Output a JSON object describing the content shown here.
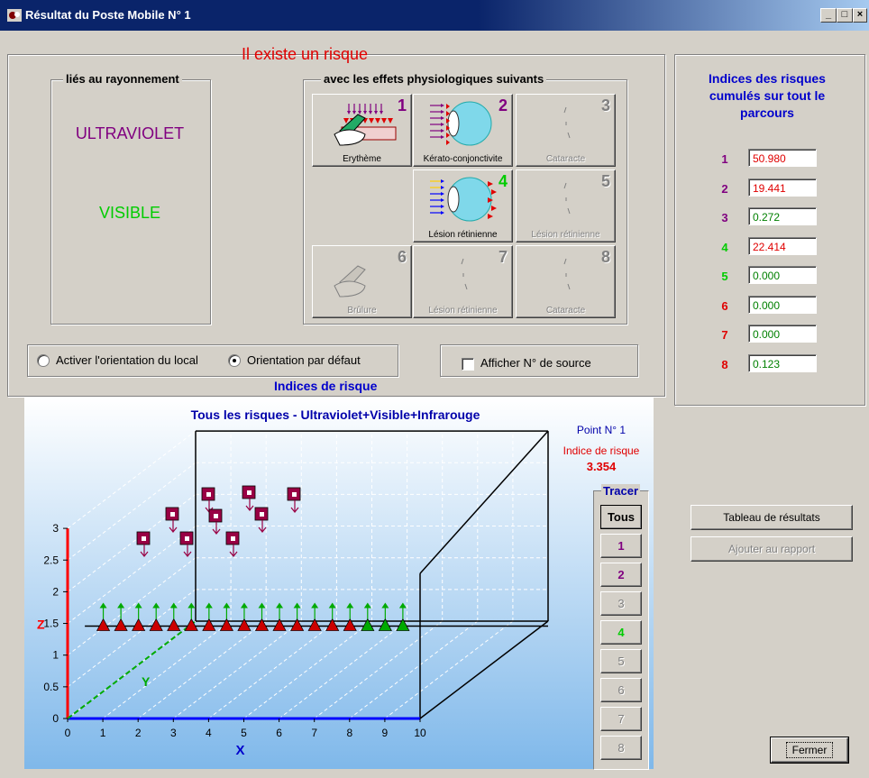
{
  "window": {
    "title": "Résultat du Poste Mobile N° 1"
  },
  "window_controls": {
    "minimize": "_",
    "maximize": "□",
    "close": "×"
  },
  "risk_heading": "Il existe un risque",
  "radiation_group": {
    "label": "liés au rayonnement",
    "items": [
      {
        "text": "ULTRAVIOLET",
        "color": "#800080"
      },
      {
        "text": "VISIBLE",
        "color": "#00cc00"
      }
    ]
  },
  "effects_group": {
    "label": "avec les effets physiologiques suivants",
    "buttons": [
      {
        "num": "1",
        "label": "Erythème",
        "enabled": true,
        "num_color": "#800080"
      },
      {
        "num": "2",
        "label": "Kérato-conjonctivite",
        "enabled": true,
        "num_color": "#800080"
      },
      {
        "num": "3",
        "label": "Cataracte",
        "enabled": false
      },
      {
        "num": "4",
        "label": "Lésion rétinienne",
        "enabled": true,
        "num_color": "#00cc00"
      },
      {
        "num": "5",
        "label": "Lésion rétinienne",
        "enabled": false
      },
      {
        "num": "6",
        "label": "Brûlure",
        "enabled": false
      },
      {
        "num": "7",
        "label": "Lésion rétinienne",
        "enabled": false
      },
      {
        "num": "8",
        "label": "Cataracte",
        "enabled": false
      }
    ]
  },
  "orientation": {
    "option_local": "Activer l'orientation du local",
    "option_default": "Orientation par défaut",
    "selected": "default"
  },
  "source_checkbox": {
    "label": "Afficher N° de source",
    "checked": false
  },
  "cumulative": {
    "title": "Indices des risques cumulés sur tout le parcours",
    "rows": [
      {
        "num": "1",
        "value": "50.980",
        "num_color": "#800080",
        "value_color": "#e00000"
      },
      {
        "num": "2",
        "value": "19.441",
        "num_color": "#800080",
        "value_color": "#e00000"
      },
      {
        "num": "3",
        "value": "0.272",
        "num_color": "#800080",
        "value_color": "#008000"
      },
      {
        "num": "4",
        "value": "22.414",
        "num_color": "#00cc00",
        "value_color": "#e00000"
      },
      {
        "num": "5",
        "value": "0.000",
        "num_color": "#00cc00",
        "value_color": "#008000"
      },
      {
        "num": "6",
        "value": "0.000",
        "num_color": "#e00000",
        "value_color": "#008000"
      },
      {
        "num": "7",
        "value": "0.000",
        "num_color": "#e00000",
        "value_color": "#008000"
      },
      {
        "num": "8",
        "value": "0.123",
        "num_color": "#e00000",
        "value_color": "#008000"
      }
    ]
  },
  "chart_section": {
    "label": "Indices de risque"
  },
  "chart_data": {
    "type": "scatter",
    "title": "Tous les risques - Ultraviolet+Visible+Infrarouge",
    "xlabel": "X",
    "ylabel": "Y",
    "zlabel": "Z",
    "xlim": [
      0,
      10
    ],
    "zlim": [
      0,
      3
    ],
    "x_ticks": [
      "0",
      "1",
      "2",
      "3",
      "4",
      "5",
      "6",
      "7",
      "8",
      "9",
      "10"
    ],
    "z_ticks": [
      "0",
      "0.5",
      "1",
      "1.5",
      "2",
      "2.5",
      "3"
    ],
    "grid": true,
    "point_info": {
      "label": "Point N° 1",
      "index_label": "Indice de risque",
      "index_value": "3.354"
    },
    "path_points": {
      "z": 1.5,
      "x": [
        1.0,
        1.5,
        2.0,
        2.5,
        3.0,
        3.5,
        4.0,
        4.5,
        5.0,
        5.5,
        6.0,
        6.5,
        7.0,
        7.5,
        8.0,
        8.5,
        9.0,
        9.5
      ],
      "risk": [
        "high",
        "high",
        "high",
        "high",
        "high",
        "high",
        "high",
        "high",
        "high",
        "high",
        "high",
        "high",
        "high",
        "high",
        "high",
        "low",
        "low",
        "low"
      ]
    },
    "sources_count": 10
  },
  "tracer": {
    "label": "Tracer",
    "buttons": [
      {
        "label": "Tous",
        "enabled": true,
        "color": "#000000"
      },
      {
        "label": "1",
        "enabled": true,
        "color": "#800080"
      },
      {
        "label": "2",
        "enabled": true,
        "color": "#800080"
      },
      {
        "label": "3",
        "enabled": false
      },
      {
        "label": "4",
        "enabled": true,
        "color": "#00cc00"
      },
      {
        "label": "5",
        "enabled": false
      },
      {
        "label": "6",
        "enabled": false
      },
      {
        "label": "7",
        "enabled": false
      },
      {
        "label": "8",
        "enabled": false
      }
    ]
  },
  "actions": {
    "results_table": "Tableau de résultats",
    "add_to_report": "Ajouter au rapport",
    "close": "Fermer"
  }
}
